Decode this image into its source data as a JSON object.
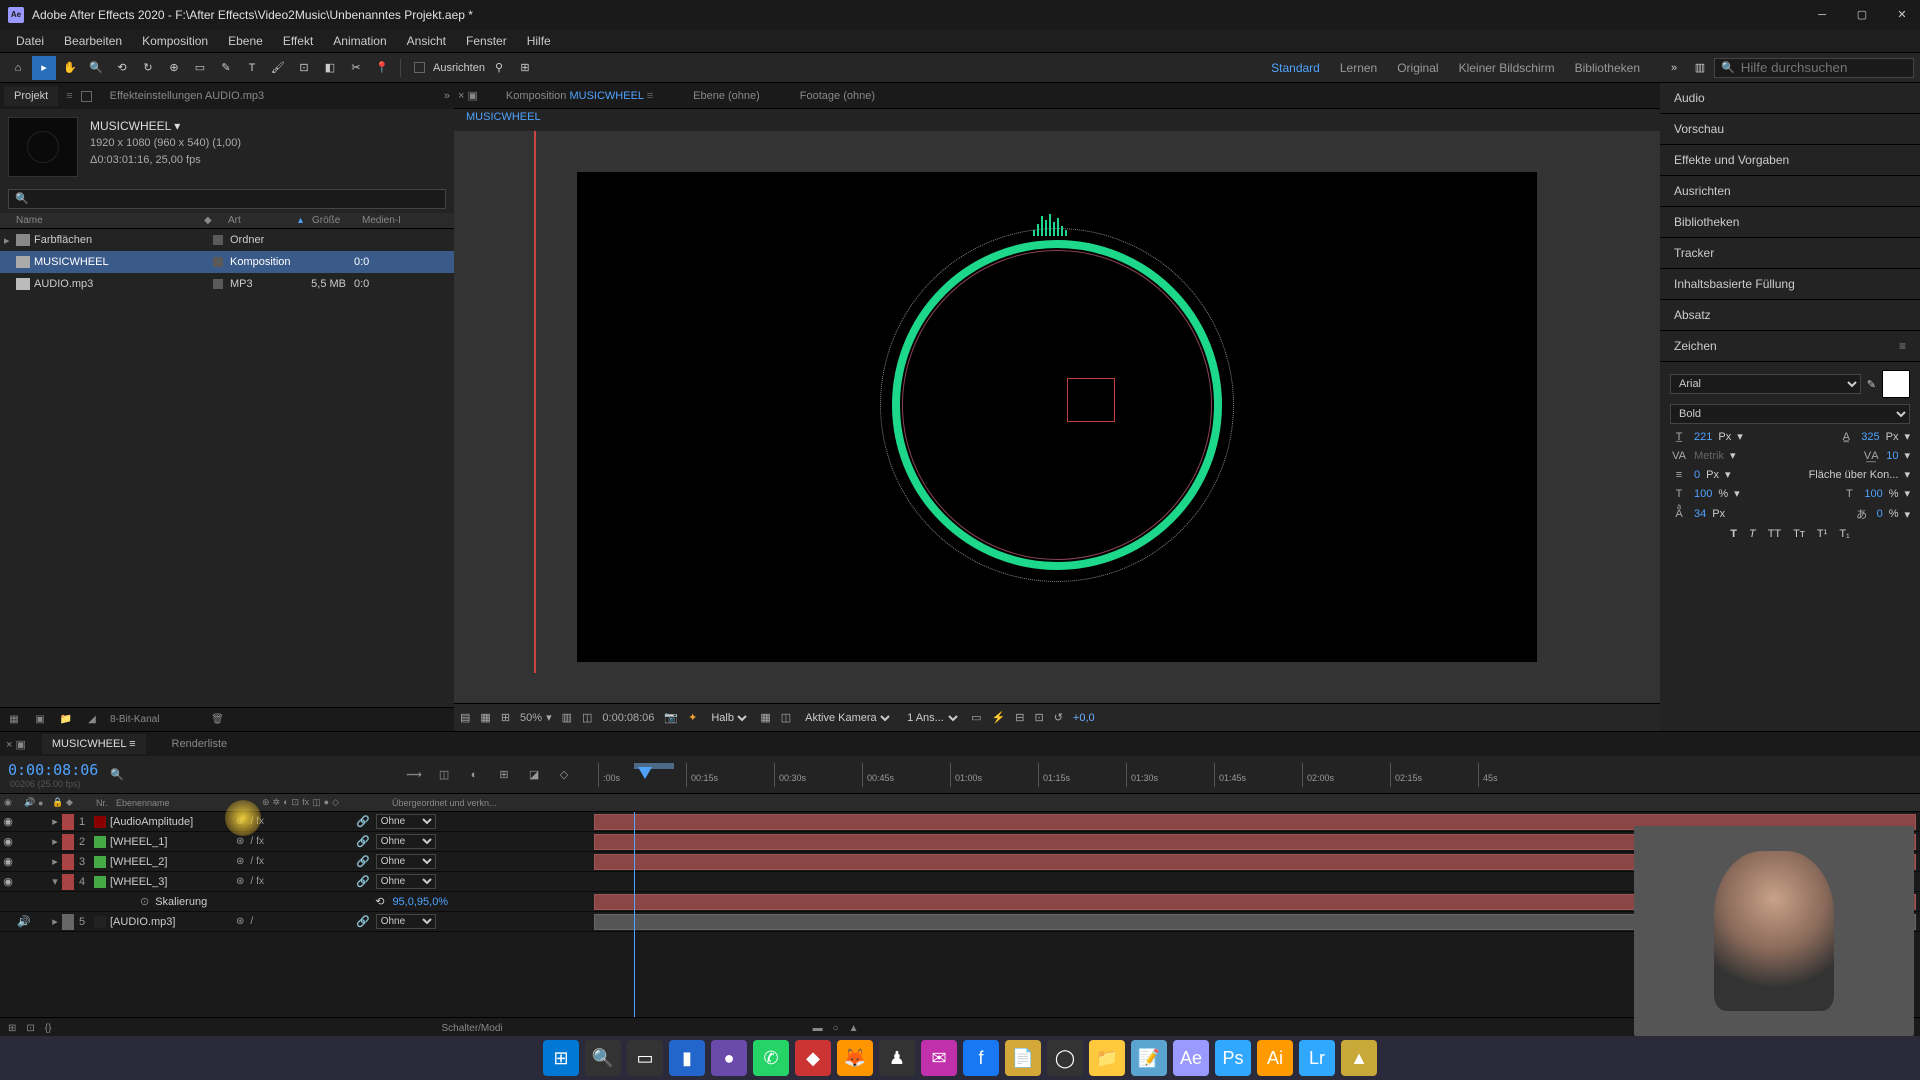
{
  "titlebar": {
    "app_icon_text": "Ae",
    "title": "Adobe After Effects 2020 - F:\\After Effects\\Video2Music\\Unbenanntes Projekt.aep *"
  },
  "menubar": [
    "Datei",
    "Bearbeiten",
    "Komposition",
    "Ebene",
    "Effekt",
    "Animation",
    "Ansicht",
    "Fenster",
    "Hilfe"
  ],
  "toolbar": {
    "snapping_label": "Ausrichten",
    "workspaces": [
      "Standard",
      "Lernen",
      "Original",
      "Kleiner Bildschirm",
      "Bibliotheken"
    ],
    "active_workspace": "Standard",
    "search_placeholder": "Hilfe durchsuchen"
  },
  "left_panel": {
    "tabs": {
      "project": "Projekt",
      "effects": "Effekteinstellungen AUDIO.mp3"
    },
    "comp": {
      "name": "MUSICWHEEL",
      "info1": "1920 x 1080 (960 x 540) (1,00)",
      "info2": "Δ0:03:01:16, 25,00 fps"
    },
    "columns": {
      "name": "Name",
      "art": "Art",
      "size": "Größe",
      "media": "Medien-I"
    },
    "rows": [
      {
        "name": "Farbflächen",
        "art": "Ordner",
        "size": "",
        "media": "",
        "icon": "folder"
      },
      {
        "name": "MUSICWHEEL",
        "art": "Komposition",
        "size": "",
        "media": "0:0",
        "icon": "comp",
        "selected": true
      },
      {
        "name": "AUDIO.mp3",
        "art": "MP3",
        "size": "5,5 MB",
        "media": "0:0",
        "icon": "audio"
      }
    ],
    "footer_label": "8-Bit-Kanal"
  },
  "center": {
    "tabs": {
      "comp_prefix": "Komposition",
      "comp_name": "MUSICWHEEL",
      "layer": "Ebene (ohne)",
      "footage": "Footage (ohne)"
    },
    "breadcrumb": "MUSICWHEEL",
    "footer": {
      "zoom": "50%",
      "timecode": "0:00:08:06",
      "res": "Halb",
      "camera": "Aktive Kamera",
      "views": "1 Ans...",
      "exposure": "+0,0"
    }
  },
  "right_panel": {
    "items": [
      "Audio",
      "Vorschau",
      "Effekte und Vorgaben",
      "Ausrichten",
      "Bibliotheken",
      "Tracker",
      "Inhaltsbasierte Füllung",
      "Absatz",
      "Zeichen"
    ],
    "zeichen": {
      "font": "Arial",
      "style": "Bold",
      "size": "221",
      "size_unit": "Px",
      "leading": "325",
      "leading_unit": "Px",
      "kerning": "Metrik",
      "tracking": "10",
      "stroke": "0",
      "stroke_unit": "Px",
      "fill_label": "Fläche über Kon...",
      "vscale": "100",
      "hscale": "100",
      "baseline": "34",
      "baseline_unit": "Px",
      "tsume": "0",
      "percent_unit": "%"
    }
  },
  "timeline": {
    "tabs": {
      "comp": "MUSICWHEEL",
      "render": "Renderliste"
    },
    "timecode": "0:00:08:06",
    "sub_timecode": "00206 (25.00 fps)",
    "columns": {
      "nr": "Nr.",
      "layer_name": "Ebenenname",
      "parent": "Übergeordnet und verkn..."
    },
    "ruler": [
      ":00s",
      "00:15s",
      "00:30s",
      "00:45s",
      "01:00s",
      "01:15s",
      "01:30s",
      "01:45s",
      "02:00s",
      "02:15s",
      "45s"
    ],
    "layers": [
      {
        "num": "1",
        "name": "[AudioAmplitude]",
        "color": "#aa4444",
        "swatch": "#880000",
        "parent": "Ohne",
        "fx": true,
        "track_color": "red"
      },
      {
        "num": "2",
        "name": "[WHEEL_1]",
        "color": "#aa4444",
        "swatch": "#44aa44",
        "parent": "Ohne",
        "fx": true,
        "track_color": "red"
      },
      {
        "num": "3",
        "name": "[WHEEL_2]",
        "color": "#aa4444",
        "swatch": "#44aa44",
        "parent": "Ohne",
        "fx": true,
        "track_color": "red"
      },
      {
        "num": "4",
        "name": "[WHEEL_3]",
        "color": "#aa4444",
        "swatch": "#44aa44",
        "parent": "Ohne",
        "fx": true,
        "track_color": "red",
        "expanded": true
      },
      {
        "num": "5",
        "name": "[AUDIO.mp3]",
        "color": "#666",
        "swatch": "#222",
        "parent": "Ohne",
        "fx": false,
        "track_color": "gray",
        "audio_only": true
      }
    ],
    "property": {
      "name": "Skalierung",
      "value": "95,0,95,0%"
    },
    "footer": "Schalter/Modi"
  },
  "taskbar_icons": [
    {
      "name": "start",
      "bg": "#0078d4",
      "glyph": "⊞"
    },
    {
      "name": "search",
      "bg": "#333",
      "glyph": "🔍"
    },
    {
      "name": "taskview",
      "bg": "#333",
      "glyph": "▭"
    },
    {
      "name": "app1",
      "bg": "#2266cc",
      "glyph": "▮"
    },
    {
      "name": "app2",
      "bg": "#6a4aaa",
      "glyph": "●"
    },
    {
      "name": "whatsapp",
      "bg": "#25d366",
      "glyph": "✆"
    },
    {
      "name": "app3",
      "bg": "#cc3333",
      "glyph": "◆"
    },
    {
      "name": "firefox",
      "bg": "#ff9500",
      "glyph": "🦊"
    },
    {
      "name": "app4",
      "bg": "#333",
      "glyph": "♟"
    },
    {
      "name": "messenger",
      "bg": "#c030aa",
      "glyph": "✉"
    },
    {
      "name": "facebook",
      "bg": "#1877f2",
      "glyph": "f"
    },
    {
      "name": "app5",
      "bg": "#d4a838",
      "glyph": "📄"
    },
    {
      "name": "obs",
      "bg": "#333",
      "glyph": "◯"
    },
    {
      "name": "explorer",
      "bg": "#ffc83d",
      "glyph": "📁"
    },
    {
      "name": "notepad",
      "bg": "#5ba4cf",
      "glyph": "📝"
    },
    {
      "name": "ae",
      "bg": "#9999ff",
      "glyph": "Ae"
    },
    {
      "name": "ps",
      "bg": "#31a8ff",
      "glyph": "Ps"
    },
    {
      "name": "ai",
      "bg": "#ff9a00",
      "glyph": "Ai"
    },
    {
      "name": "lr",
      "bg": "#31a8ff",
      "glyph": "Lr"
    },
    {
      "name": "app6",
      "bg": "#c8a838",
      "glyph": "▲"
    }
  ]
}
